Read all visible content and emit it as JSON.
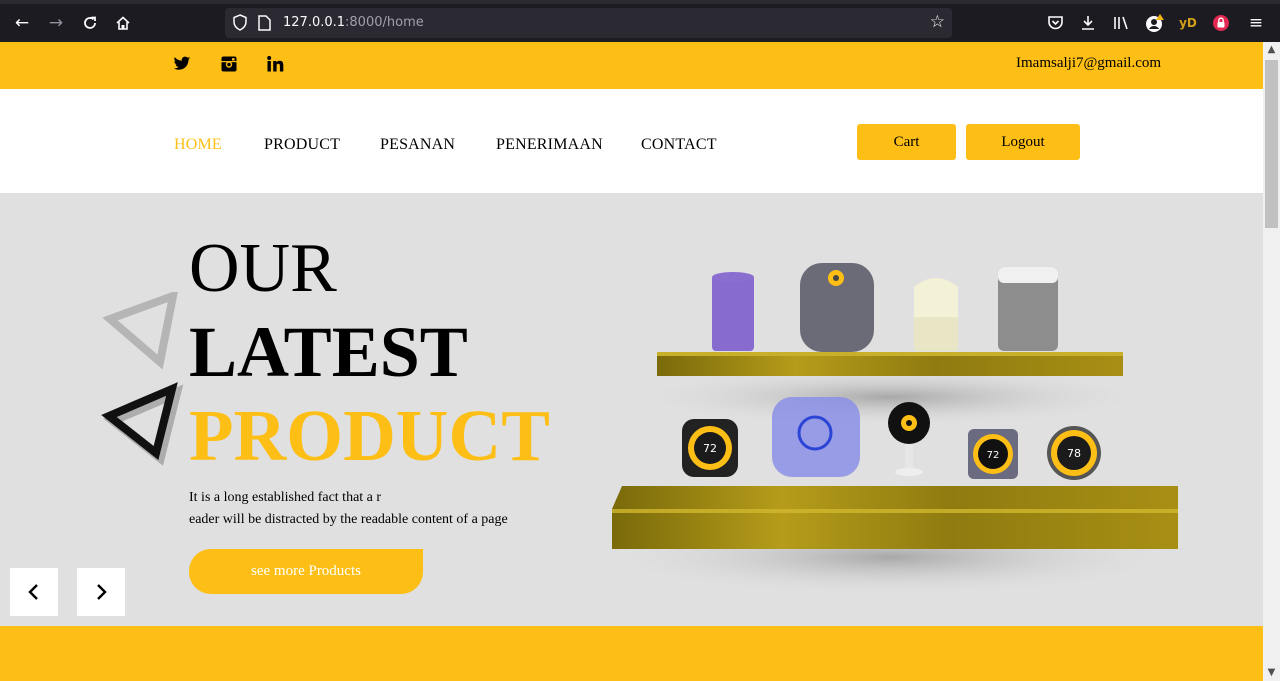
{
  "browser": {
    "url_host": "127.0.0.1",
    "url_rest": ":8000/home",
    "ext_label": "yD"
  },
  "topbar": {
    "email": "Imamsalji7@gmail.com",
    "social_icons": [
      "twitter-icon",
      "instagram-icon",
      "linkedin-icon"
    ]
  },
  "nav": {
    "items": [
      {
        "label": "HOME",
        "active": true
      },
      {
        "label": "PRODUCT"
      },
      {
        "label": "PESANAN"
      },
      {
        "label": "PENERIMAAN"
      },
      {
        "label": "CONTACT"
      }
    ],
    "cart_label": "Cart",
    "logout_label": "Logout"
  },
  "hero": {
    "line1": "OUR",
    "line2": "LATEST",
    "line3": "PRODUCT",
    "desc_line1": "It is a long established fact that a r",
    "desc_line2": "eader will be distracted by the readable content of a page",
    "cta_label": "see more Products",
    "thermostat_a": "72",
    "thermostat_b": "72",
    "thermostat_c": "78"
  },
  "colors": {
    "accent": "#fdbf16",
    "hero_bg": "#e0e0e0"
  }
}
